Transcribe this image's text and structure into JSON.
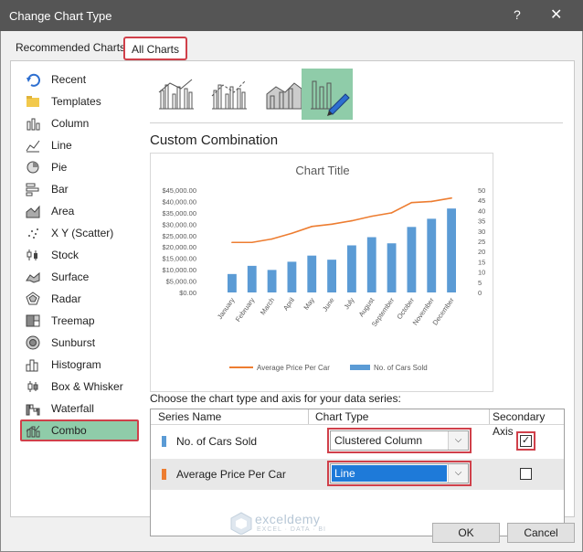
{
  "window": {
    "title": "Change Chart Type",
    "help": "?",
    "close": "✕"
  },
  "tabs": {
    "recommended": "Recommended Charts",
    "all": "All Charts"
  },
  "sidebar": {
    "items": [
      {
        "label": "Recent",
        "icon": "recent-icon"
      },
      {
        "label": "Templates",
        "icon": "folder-icon"
      },
      {
        "label": "Column",
        "icon": "column-chart-icon"
      },
      {
        "label": "Line",
        "icon": "line-chart-icon"
      },
      {
        "label": "Pie",
        "icon": "pie-chart-icon"
      },
      {
        "label": "Bar",
        "icon": "bar-chart-icon"
      },
      {
        "label": "Area",
        "icon": "area-chart-icon"
      },
      {
        "label": "X Y (Scatter)",
        "icon": "scatter-chart-icon"
      },
      {
        "label": "Stock",
        "icon": "stock-chart-icon"
      },
      {
        "label": "Surface",
        "icon": "surface-chart-icon"
      },
      {
        "label": "Radar",
        "icon": "radar-chart-icon"
      },
      {
        "label": "Treemap",
        "icon": "treemap-chart-icon"
      },
      {
        "label": "Sunburst",
        "icon": "sunburst-chart-icon"
      },
      {
        "label": "Histogram",
        "icon": "histogram-chart-icon"
      },
      {
        "label": "Box & Whisker",
        "icon": "box-whisker-chart-icon"
      },
      {
        "label": "Waterfall",
        "icon": "waterfall-chart-icon"
      },
      {
        "label": "Combo",
        "icon": "combo-chart-icon"
      }
    ],
    "selected": "Combo"
  },
  "section_title": "Custom Combination",
  "preview_chart": {
    "title": "Chart Title",
    "legend": {
      "line": "Average Price Per Car",
      "bar": "No. of Cars Sold"
    }
  },
  "chart_data": {
    "type": "bar",
    "title": "Chart Title",
    "categories": [
      "January",
      "February",
      "March",
      "April",
      "May",
      "June",
      "July",
      "August",
      "September",
      "October",
      "November",
      "December"
    ],
    "series": [
      {
        "name": "No. of Cars Sold",
        "type": "bar",
        "axis": "secondary",
        "values": [
          9,
          13,
          11,
          15,
          18,
          16,
          23,
          27,
          24,
          32,
          36,
          41
        ]
      },
      {
        "name": "Average Price Per Car",
        "type": "line",
        "axis": "primary",
        "values": [
          22000,
          22000,
          23500,
          26000,
          29000,
          30000,
          31500,
          33500,
          35000,
          39500,
          40000,
          41500
        ]
      }
    ],
    "y_primary": {
      "ylim": [
        0,
        45000
      ],
      "ticks": [
        "$0.00",
        "$5,000.00",
        "$10,000.00",
        "$15,000.00",
        "$20,000.00",
        "$25,000.00",
        "$30,000.00",
        "$35,000.00",
        "$40,000.00",
        "$45,000.00"
      ]
    },
    "y_secondary": {
      "ylim": [
        0,
        50
      ],
      "ticks": [
        "0",
        "5",
        "10",
        "15",
        "20",
        "25",
        "30",
        "35",
        "40",
        "45",
        "50"
      ]
    },
    "colors": {
      "bar": "#5b9bd5",
      "line": "#ed7d31"
    },
    "legend_position": "bottom",
    "grid": false
  },
  "series_table": {
    "prompt": "Choose the chart type and axis for your data series:",
    "headers": {
      "name": "Series Name",
      "type": "Chart Type",
      "secondary": "Secondary Axis"
    },
    "rows": [
      {
        "name": "No. of Cars Sold",
        "color": "#5b9bd5",
        "chart_type": "Clustered Column",
        "secondary_axis": true
      },
      {
        "name": "Average Price Per Car",
        "color": "#ed7d31",
        "chart_type": "Line",
        "secondary_axis": false
      }
    ],
    "checkmark": "✓",
    "arrow": "⌵"
  },
  "watermark": {
    "brand": "exceldemy",
    "tagline": "EXCEL · DATA · BI"
  },
  "buttons": {
    "ok": "OK",
    "cancel": "Cancel"
  },
  "accent_color": "#d0404a",
  "selected_fill": "#8fcca9"
}
